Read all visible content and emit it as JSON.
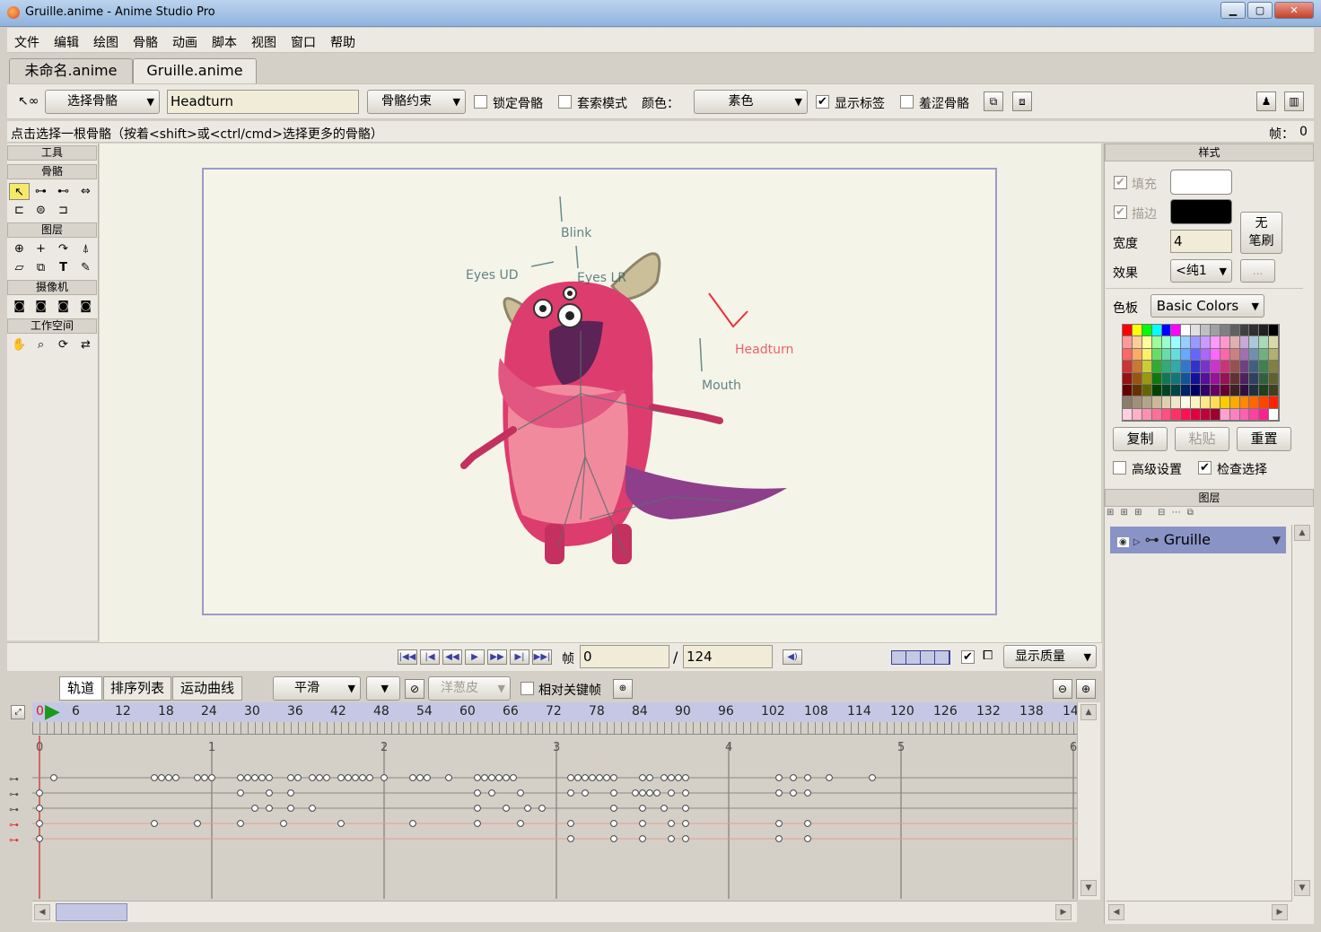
{
  "window": {
    "title": "Gruille.anime - Anime Studio Pro",
    "min": "▁",
    "max": "▢",
    "close": "✕"
  },
  "menu": [
    "文件",
    "编辑",
    "绘图",
    "骨骼",
    "动画",
    "脚本",
    "视图",
    "窗口",
    "帮助"
  ],
  "doc_tabs": [
    "未命名.anime",
    "Gruille.anime"
  ],
  "toolbar": {
    "mode_dropdown": "选择骨骼",
    "bone_name": "Headturn",
    "constraint_dropdown": "骨骼约束",
    "lock_bone": "锁定骨骼",
    "lasso_mode": "套索模式",
    "color_label": "颜色：",
    "color_dropdown": "素色",
    "show_labels": "显示标签",
    "shy_bones": "羞涩骨骼"
  },
  "status": {
    "hint": "点击选择一根骨骼（按着<shift>或<ctrl/cmd>选择更多的骨骼）",
    "frame_label": "帧：",
    "frame_value": "0"
  },
  "tools": {
    "title": "工具",
    "bones": "骨骼",
    "layers": "图层",
    "camera": "摄像机",
    "workspace": "工作空间"
  },
  "canvas": {
    "labels": [
      {
        "text": "Blink",
        "color": "#2e5e66"
      },
      {
        "text": "Eyes UD",
        "color": "#2e5e66"
      },
      {
        "text": "Eyes LR",
        "color": "#2e5e66"
      },
      {
        "text": "Headturn",
        "color": "#e8313c"
      },
      {
        "text": "Mouth",
        "color": "#2e5e66"
      }
    ]
  },
  "playback": {
    "frame_label": "帧",
    "frame": "0",
    "sep": "/",
    "total": "124",
    "quality": "显示质量"
  },
  "timeline": {
    "tabs": [
      "轨道",
      "排序列表",
      "运动曲线"
    ],
    "interp": "平滑",
    "onion": "洋葱皮",
    "relative": "相对关键帧",
    "ruler": [
      "0",
      "6",
      "12",
      "18",
      "24",
      "30",
      "36",
      "42",
      "48",
      "54",
      "60",
      "66",
      "72",
      "78",
      "84",
      "90",
      "96",
      "102",
      "108",
      "114",
      "120",
      "126",
      "132",
      "138",
      "14"
    ],
    "seconds": [
      "0",
      "1",
      "2",
      "3",
      "4",
      "5",
      "6"
    ],
    "tracks": [
      {
        "color": "#8a8880",
        "keys": [
          2,
          16,
          17,
          18,
          19,
          22,
          23,
          24,
          28,
          29,
          30,
          31,
          32,
          35,
          36,
          38,
          39,
          40,
          42,
          43,
          44,
          45,
          46,
          48,
          52,
          53,
          54,
          57,
          61,
          62,
          63,
          64,
          65,
          66,
          74,
          75,
          76,
          77,
          78,
          79,
          80,
          84,
          85,
          87,
          88,
          89,
          90,
          103,
          105,
          107,
          110,
          116
        ]
      },
      {
        "color": "#8a8880",
        "keys": [
          0,
          28,
          32,
          35,
          61,
          63,
          67,
          74,
          76,
          80,
          83,
          84,
          85,
          86,
          88,
          90,
          103,
          105,
          107
        ]
      },
      {
        "color": "#8a8880",
        "keys": [
          0,
          30,
          32,
          35,
          38,
          61,
          65,
          68,
          70,
          80,
          84,
          87,
          90
        ]
      },
      {
        "color": "#e89a95",
        "keys": [
          0,
          16,
          22,
          28,
          34,
          42,
          52,
          61,
          67,
          74,
          80,
          84,
          88,
          90,
          103,
          107
        ]
      },
      {
        "color": "#e89a95",
        "keys": [
          0,
          74,
          80,
          84,
          88,
          90,
          103,
          107
        ]
      }
    ]
  },
  "style_panel": {
    "title": "样式",
    "fill": "填充",
    "stroke": "描边",
    "width_label": "宽度",
    "width": "4",
    "no_brush": [
      "无",
      "笔刷"
    ],
    "effect_label": "效果",
    "effect": "<纯1",
    "effect_btn": "...",
    "palette_label": "色板",
    "palette": "Basic Colors",
    "copy": "复制",
    "paste": "粘贴",
    "reset": "重置",
    "advanced": "高级设置",
    "check_select": "检查选择",
    "fill_color": "#ffffff",
    "stroke_color": "#000000"
  },
  "layers_panel": {
    "title": "图层",
    "layer": "Gruille"
  }
}
